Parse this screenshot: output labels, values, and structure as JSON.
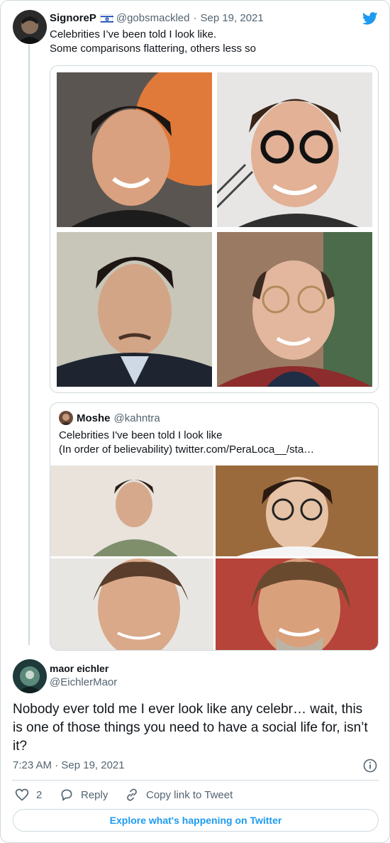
{
  "tweet": {
    "author_name": "SignoreP",
    "author_flag": "🇮🇱",
    "handle": "@gobsmackled",
    "separator": "·",
    "date": "Sep 19, 2021",
    "text_line1": "Celebrities I’ve been told I look like.",
    "text_line2": "Some comparisons flattering, others less so"
  },
  "quote": {
    "author_name": "Moshe",
    "handle": "@kahntra",
    "text_line1": "Celebrities I've been told I look like",
    "text_line2": "(In order of believability) twitter.com/PeraLoca__/sta…"
  },
  "reply": {
    "author_name": "maor eichler",
    "handle": "@EichlerMaor",
    "text": "Nobody ever told me I ever look like any celebr… wait, this is one of those things you need to have a social life for, isn’t it?",
    "time": "7:23 AM · Sep 19, 2021"
  },
  "actions": {
    "like_count": "2",
    "reply_label": "Reply",
    "copy_label": "Copy link to Tweet"
  },
  "footer": {
    "explore_label": "Explore what's happening on Twitter"
  },
  "colors": {
    "accent": "#1d9bf0",
    "muted": "#536471",
    "border": "#cfd9de"
  },
  "icons": [
    "twitter-bird-icon",
    "israel-flag-icon",
    "info-icon",
    "heart-icon",
    "reply-icon",
    "link-icon"
  ]
}
